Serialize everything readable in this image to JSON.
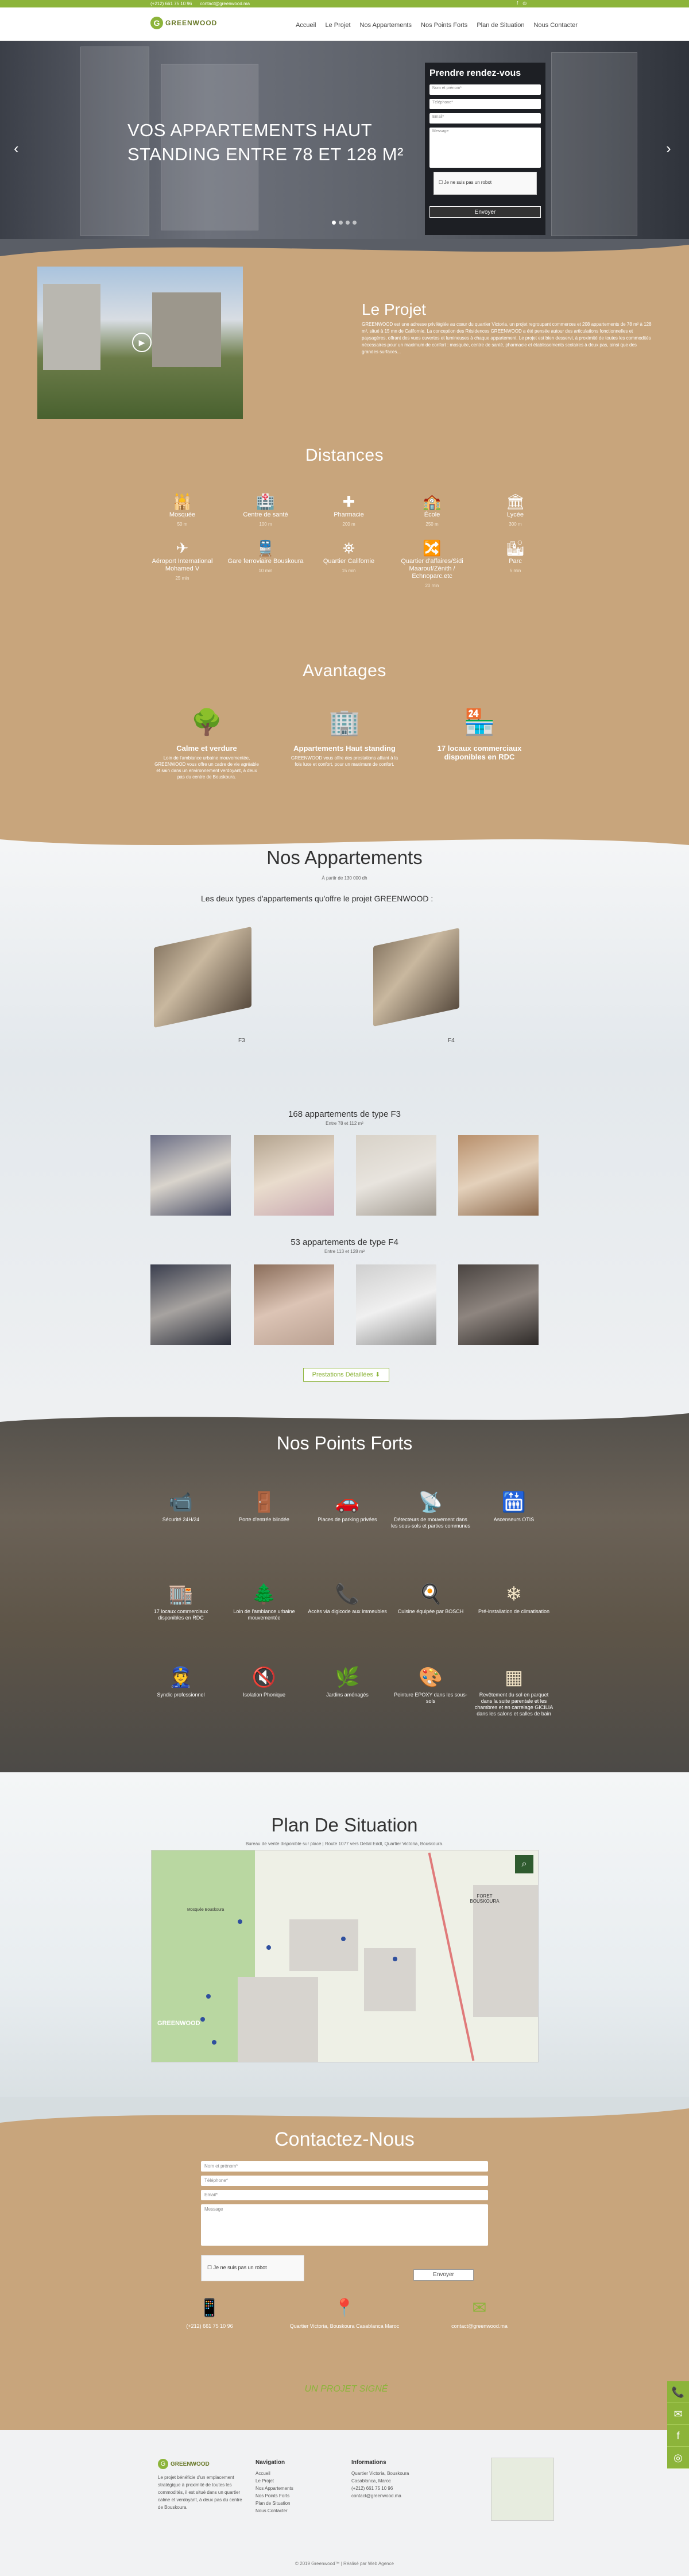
{
  "topbar": {
    "phone": "(+212) 661 75 10 96",
    "email": "contact@greenwood.ma",
    "social": [
      "f",
      "◎"
    ]
  },
  "header": {
    "logo_text": "GREENWOOD",
    "nav": [
      "Accueil",
      "Le Projet",
      "Nos Appartements",
      "Nos Points Forts",
      "Plan de Situation",
      "Nous Contacter"
    ]
  },
  "hero": {
    "title": "VOS APPARTEMENTS HAUT STANDING ENTRE 78 ET 128 M²",
    "slide_count": 4,
    "active_slide": 1,
    "form": {
      "title": "Prendre rendez-vous",
      "name_ph": "Nom et prénom*",
      "phone_ph": "Téléphone*",
      "email_ph": "Email*",
      "message_ph": "Message",
      "captcha": "Je ne suis pas un robot",
      "send": "Envoyer"
    }
  },
  "projet": {
    "title": "Le Projet",
    "text": "GREENWOOD est une adresse privilégiée au cœur du quartier Victoria, un projet regroupant commerces et 208 appartements de 78 m² à 128 m², situé à 15 mn de Californie. La conception des Résidences GREENWOOD a été pensée autour des articulations fonctionnelles et paysagères, offrant des vues ouvertes et lumineuses à chaque appartement. Le projet est bien desservi, à proximité de toutes les commodités nécessaires pour un maximum de confort : mosquée, centre de santé, pharmacie et établissements scolaires à deux pas, ainsi que des grandes surfaces..."
  },
  "distances": {
    "title": "Distances",
    "items": [
      {
        "icon": "🕌",
        "label": "Mosquée",
        "dist": "50 m"
      },
      {
        "icon": "🏥",
        "label": "Centre de santé",
        "dist": "100 m"
      },
      {
        "icon": "✚",
        "label": "Pharmacie",
        "dist": "200 m"
      },
      {
        "icon": "🏫",
        "label": "École",
        "dist": "250 m"
      },
      {
        "icon": "🏛",
        "label": "Lycée",
        "dist": "300 m"
      },
      {
        "icon": "✈",
        "label": "Aéroport International Mohamed V",
        "dist": "25 min"
      },
      {
        "icon": "🚆",
        "label": "Gare ferroviaire Bouskoura",
        "dist": "10 min"
      },
      {
        "icon": "⛯",
        "label": "Quartier Californie",
        "dist": "15 min"
      },
      {
        "icon": "🔀",
        "label": "Quartier d'affaires/Sidi Maarouf/Zénith / Echnoparc.etc",
        "dist": "20 min"
      },
      {
        "icon": "🏙",
        "label": "Parc",
        "dist": "5 min"
      }
    ]
  },
  "avantages": {
    "title": "Avantages",
    "items": [
      {
        "icon": "🌳",
        "title": "Calme et verdure",
        "text": "Loin de l'ambiance urbaine mouvementée, GREENWOOD vous offre un cadre de vie agréable et sain dans un environnement verdoyant, à deux pas du centre de Bouskoura."
      },
      {
        "icon": "🏢",
        "title": "Appartements Haut standing",
        "text": "GREENWOOD vous offre des prestations alliant à la fois luxe et confort, pour un maximum de confort."
      },
      {
        "icon": "🏪",
        "title": "17 locaux commerciaux disponibles en RDC",
        "text": ""
      }
    ]
  },
  "apts": {
    "title": "Nos Appartements",
    "sub": "À partir de 130 000 dh",
    "intro": "Les deux  types d'appartements qu'offre le projet GREENWOOD :",
    "plans": [
      "F3",
      "F4"
    ],
    "f3": {
      "title": "168 appartements de type F3",
      "surface": "Entre 78 et 112 m²"
    },
    "f4": {
      "title": "53 appartements de type F4",
      "surface": "Entre 113 et 128 m²"
    },
    "presta": "Prestations Détaillées ⬇"
  },
  "forts": {
    "title": "Nos Points Forts",
    "items": [
      {
        "icon": "📹",
        "label": "Sécurité 24H/24"
      },
      {
        "icon": "🚪",
        "label": "Porte d'entrée blindée"
      },
      {
        "icon": "🚗",
        "label": "Places de parking privées"
      },
      {
        "icon": "📡",
        "label": "Détecteurs de mouvement dans les sous-sols et parties communes"
      },
      {
        "icon": "🛗",
        "label": "Ascenseurs OTIS"
      },
      {
        "icon": "🏬",
        "label": "17 locaux commerciaux disponibles en RDC"
      },
      {
        "icon": "🌲",
        "label": "Loin de l'ambiance urbaine mouvementée"
      },
      {
        "icon": "📞",
        "label": "Accès via digicode aux immeubles"
      },
      {
        "icon": "🍳",
        "label": "Cuisine équipée par BOSCH"
      },
      {
        "icon": "❄",
        "label": "Pré-installation de climatisation"
      },
      {
        "icon": "👮",
        "label": "Syndic professionnel"
      },
      {
        "icon": "🔇",
        "label": "Isolation Phonique"
      },
      {
        "icon": "🌿",
        "label": "Jardins aménagés"
      },
      {
        "icon": "🎨",
        "label": "Peinture EPOXY dans les sous-sols"
      },
      {
        "icon": "▦",
        "label": "Revêtement du sol en parquet dans la suite parentale et les chambres et en carrelage GICILIA dans les salons et salles de bain"
      }
    ]
  },
  "situation": {
    "title": "Plan De Situation",
    "sub": "Bureau de vente disponible sur place | Route 1077 vers Dellal Eddl, Quartier Victoria, Bouskoura.",
    "labels": {
      "forest": "FORET BOUSKOURA",
      "logo": "GREENWOOD",
      "mosque": "Mosquée Bouskoura"
    }
  },
  "contact": {
    "title": "Contactez-Nous",
    "name_ph": "Nom et prénom*",
    "phone_ph": "Téléphone*",
    "email_ph": "Email*",
    "msg_ph": "Message",
    "captcha": "Je ne suis pas un robot",
    "send": "Envoyer",
    "phone": "(+212) 661 75 10 96",
    "address": "Quartier Victoria, Bouskoura Casablanca Maroc",
    "email": "contact@greenwood.ma",
    "signed": "UN PROJET SIGNÉ"
  },
  "footer": {
    "about": "Le projet bénéficie d'un emplacement stratégique à proximité de toutes les commodités, il est situé dans un quartier calme et verdoyant, à deux pas du centre de Bouskoura.",
    "nav_title": "Navigation",
    "nav": [
      "Accueil",
      "Le Projet",
      "Nos Appartements",
      "Nos Points Forts",
      "Plan de Situation",
      "Nous Contacter"
    ],
    "info_title": "Informations",
    "info": [
      "Quartier Victoria, Bouskoura",
      "Casablanca, Maroc",
      "(+212) 661 75 10 96",
      "contact@greenwood.ma"
    ],
    "copyright": "© 2019 Greenwood™ | Réalisé par Web Agence"
  },
  "side": [
    "📞",
    "✉",
    "f",
    "◎"
  ],
  "colors": {
    "green": "#8cb43a",
    "tan": "#c8a57c"
  }
}
